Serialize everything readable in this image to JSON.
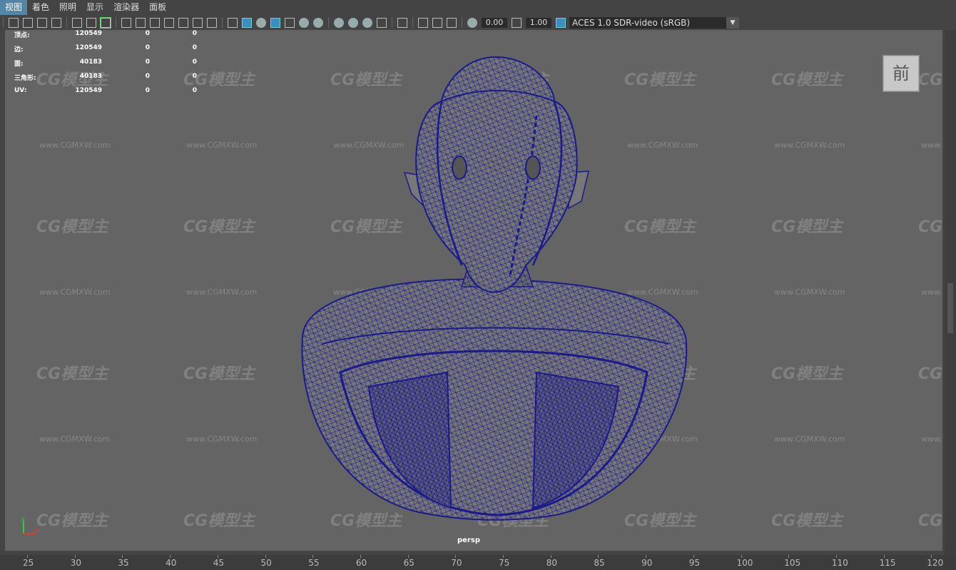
{
  "menu": [
    "视图",
    "着色",
    "照明",
    "显示",
    "渲染器",
    "面板"
  ],
  "toolbar": {
    "exposure_value": "0.00",
    "gamma_value": "1.00",
    "color_space": "ACES 1.0 SDR-video (sRGB)"
  },
  "hud": [
    {
      "label": "顶点:",
      "v1": "120549",
      "v2": "0",
      "v3": "0"
    },
    {
      "label": "边:",
      "v1": "120549",
      "v2": "0",
      "v3": "0"
    },
    {
      "label": "面:",
      "v1": "40183",
      "v2": "0",
      "v3": "0"
    },
    {
      "label": "三角形:",
      "v1": "40183",
      "v2": "0",
      "v3": "0"
    },
    {
      "label": "UV:",
      "v1": "120549",
      "v2": "0",
      "v3": "0"
    }
  ],
  "viewcube_label": "前",
  "camera_label": "persp",
  "watermark_logo": "CG模型主",
  "watermark_url": "www.CGMXW.com",
  "timeline_ticks": [
    "25",
    "30",
    "35",
    "40",
    "45",
    "50",
    "55",
    "60",
    "65",
    "70",
    "75",
    "80",
    "85",
    "90",
    "95",
    "100",
    "105",
    "110",
    "115",
    "120"
  ],
  "colors": {
    "accent": "#5285a6",
    "mesh": "#1a1a8c",
    "viewport_bg": "#646464"
  },
  "icons": [
    "camera-icon",
    "select-camera-icon",
    "lock-camera-icon",
    "bookmark-icon",
    "image-plane-icon",
    "grid-icon",
    "film-gate-icon",
    "resolution-gate-icon",
    "gate-mask-icon",
    "field-chart-icon",
    "safe-action-icon",
    "safe-title-icon",
    "wireframe-icon",
    "smooth-shade-icon",
    "wireframe-on-shaded-icon",
    "xray-icon",
    "use-default-material-icon",
    "lights-icon",
    "shadows-icon",
    "screen-space-ao-icon",
    "motion-blur-icon",
    "multisample-aa-icon",
    "depth-of-field-icon",
    "isolate-select-icon",
    "xray-joints-icon",
    "xray-active-icon",
    "backface-icon",
    "exposure-icon",
    "gamma-icon",
    "color-management-icon"
  ]
}
